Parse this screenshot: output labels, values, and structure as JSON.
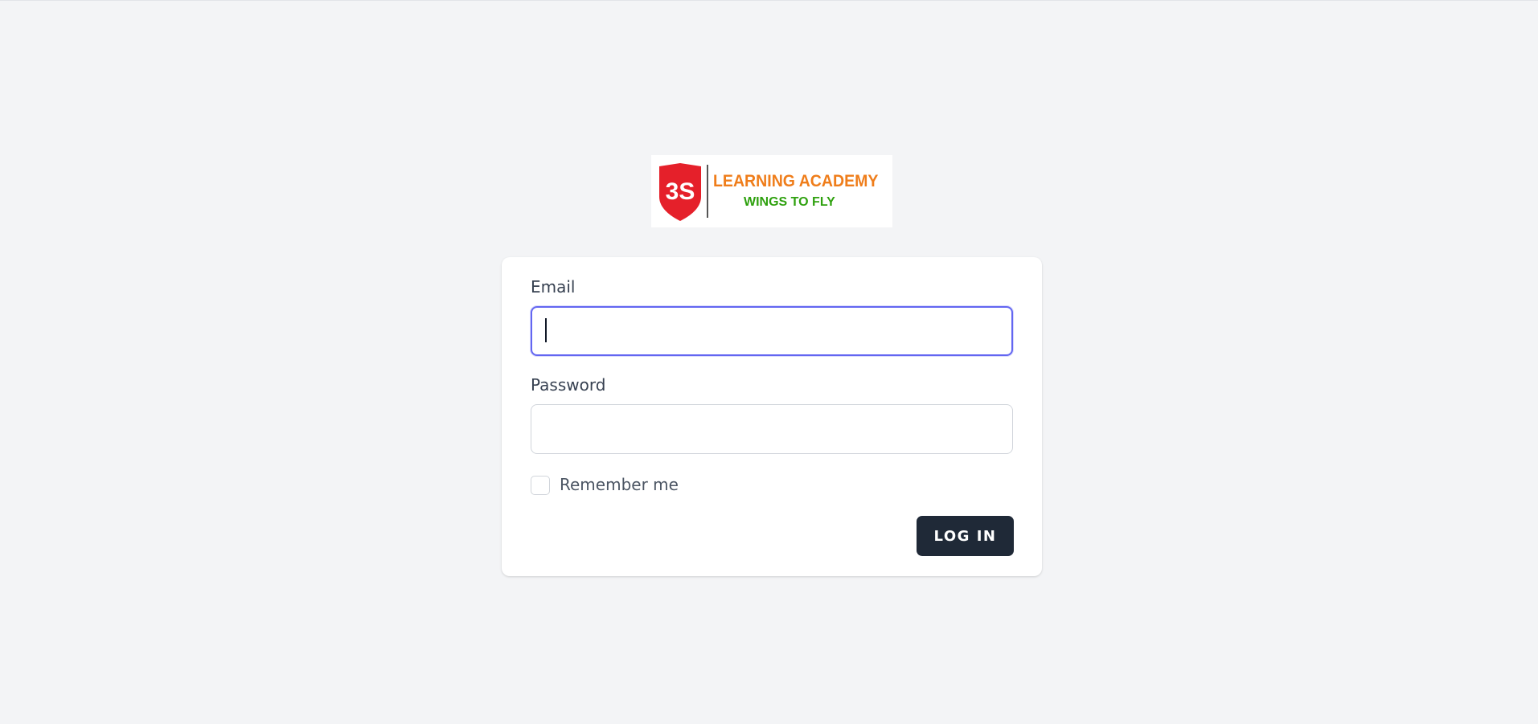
{
  "logo": {
    "shield_text": "3S",
    "main_text": "LEARNING ACADEMY",
    "sub_text": "WINGS TO FLY",
    "shield_color": "#e5202a",
    "main_text_color": "#ef7d1a",
    "sub_text_color": "#2fa10f"
  },
  "form": {
    "email_label": "Email",
    "email_value": "",
    "password_label": "Password",
    "password_value": "",
    "remember_label": "Remember me",
    "remember_checked": false,
    "login_label": "LOG IN"
  },
  "colors": {
    "background": "#f3f4f6",
    "focus_ring": "#6366f1",
    "button": "#1f2937"
  }
}
